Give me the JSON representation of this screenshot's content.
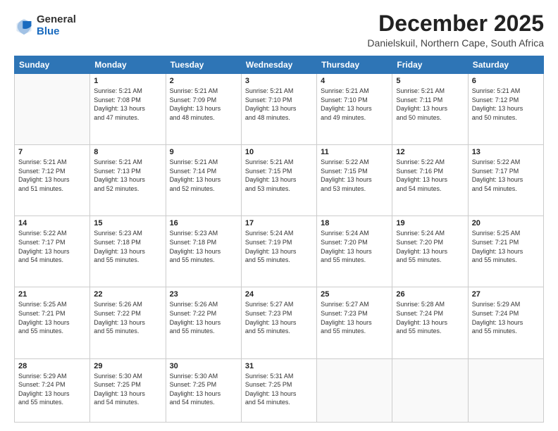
{
  "logo": {
    "general": "General",
    "blue": "Blue"
  },
  "header": {
    "month": "December 2025",
    "location": "Danielskuil, Northern Cape, South Africa"
  },
  "weekdays": [
    "Sunday",
    "Monday",
    "Tuesday",
    "Wednesday",
    "Thursday",
    "Friday",
    "Saturday"
  ],
  "weeks": [
    [
      {
        "day": "",
        "info": ""
      },
      {
        "day": "1",
        "info": "Sunrise: 5:21 AM\nSunset: 7:08 PM\nDaylight: 13 hours\nand 47 minutes."
      },
      {
        "day": "2",
        "info": "Sunrise: 5:21 AM\nSunset: 7:09 PM\nDaylight: 13 hours\nand 48 minutes."
      },
      {
        "day": "3",
        "info": "Sunrise: 5:21 AM\nSunset: 7:10 PM\nDaylight: 13 hours\nand 48 minutes."
      },
      {
        "day": "4",
        "info": "Sunrise: 5:21 AM\nSunset: 7:10 PM\nDaylight: 13 hours\nand 49 minutes."
      },
      {
        "day": "5",
        "info": "Sunrise: 5:21 AM\nSunset: 7:11 PM\nDaylight: 13 hours\nand 50 minutes."
      },
      {
        "day": "6",
        "info": "Sunrise: 5:21 AM\nSunset: 7:12 PM\nDaylight: 13 hours\nand 50 minutes."
      }
    ],
    [
      {
        "day": "7",
        "info": "Sunrise: 5:21 AM\nSunset: 7:12 PM\nDaylight: 13 hours\nand 51 minutes."
      },
      {
        "day": "8",
        "info": "Sunrise: 5:21 AM\nSunset: 7:13 PM\nDaylight: 13 hours\nand 52 minutes."
      },
      {
        "day": "9",
        "info": "Sunrise: 5:21 AM\nSunset: 7:14 PM\nDaylight: 13 hours\nand 52 minutes."
      },
      {
        "day": "10",
        "info": "Sunrise: 5:21 AM\nSunset: 7:15 PM\nDaylight: 13 hours\nand 53 minutes."
      },
      {
        "day": "11",
        "info": "Sunrise: 5:22 AM\nSunset: 7:15 PM\nDaylight: 13 hours\nand 53 minutes."
      },
      {
        "day": "12",
        "info": "Sunrise: 5:22 AM\nSunset: 7:16 PM\nDaylight: 13 hours\nand 54 minutes."
      },
      {
        "day": "13",
        "info": "Sunrise: 5:22 AM\nSunset: 7:17 PM\nDaylight: 13 hours\nand 54 minutes."
      }
    ],
    [
      {
        "day": "14",
        "info": "Sunrise: 5:22 AM\nSunset: 7:17 PM\nDaylight: 13 hours\nand 54 minutes."
      },
      {
        "day": "15",
        "info": "Sunrise: 5:23 AM\nSunset: 7:18 PM\nDaylight: 13 hours\nand 55 minutes."
      },
      {
        "day": "16",
        "info": "Sunrise: 5:23 AM\nSunset: 7:18 PM\nDaylight: 13 hours\nand 55 minutes."
      },
      {
        "day": "17",
        "info": "Sunrise: 5:24 AM\nSunset: 7:19 PM\nDaylight: 13 hours\nand 55 minutes."
      },
      {
        "day": "18",
        "info": "Sunrise: 5:24 AM\nSunset: 7:20 PM\nDaylight: 13 hours\nand 55 minutes."
      },
      {
        "day": "19",
        "info": "Sunrise: 5:24 AM\nSunset: 7:20 PM\nDaylight: 13 hours\nand 55 minutes."
      },
      {
        "day": "20",
        "info": "Sunrise: 5:25 AM\nSunset: 7:21 PM\nDaylight: 13 hours\nand 55 minutes."
      }
    ],
    [
      {
        "day": "21",
        "info": "Sunrise: 5:25 AM\nSunset: 7:21 PM\nDaylight: 13 hours\nand 55 minutes."
      },
      {
        "day": "22",
        "info": "Sunrise: 5:26 AM\nSunset: 7:22 PM\nDaylight: 13 hours\nand 55 minutes."
      },
      {
        "day": "23",
        "info": "Sunrise: 5:26 AM\nSunset: 7:22 PM\nDaylight: 13 hours\nand 55 minutes."
      },
      {
        "day": "24",
        "info": "Sunrise: 5:27 AM\nSunset: 7:23 PM\nDaylight: 13 hours\nand 55 minutes."
      },
      {
        "day": "25",
        "info": "Sunrise: 5:27 AM\nSunset: 7:23 PM\nDaylight: 13 hours\nand 55 minutes."
      },
      {
        "day": "26",
        "info": "Sunrise: 5:28 AM\nSunset: 7:24 PM\nDaylight: 13 hours\nand 55 minutes."
      },
      {
        "day": "27",
        "info": "Sunrise: 5:29 AM\nSunset: 7:24 PM\nDaylight: 13 hours\nand 55 minutes."
      }
    ],
    [
      {
        "day": "28",
        "info": "Sunrise: 5:29 AM\nSunset: 7:24 PM\nDaylight: 13 hours\nand 55 minutes."
      },
      {
        "day": "29",
        "info": "Sunrise: 5:30 AM\nSunset: 7:25 PM\nDaylight: 13 hours\nand 54 minutes."
      },
      {
        "day": "30",
        "info": "Sunrise: 5:30 AM\nSunset: 7:25 PM\nDaylight: 13 hours\nand 54 minutes."
      },
      {
        "day": "31",
        "info": "Sunrise: 5:31 AM\nSunset: 7:25 PM\nDaylight: 13 hours\nand 54 minutes."
      },
      {
        "day": "",
        "info": ""
      },
      {
        "day": "",
        "info": ""
      },
      {
        "day": "",
        "info": ""
      }
    ]
  ]
}
